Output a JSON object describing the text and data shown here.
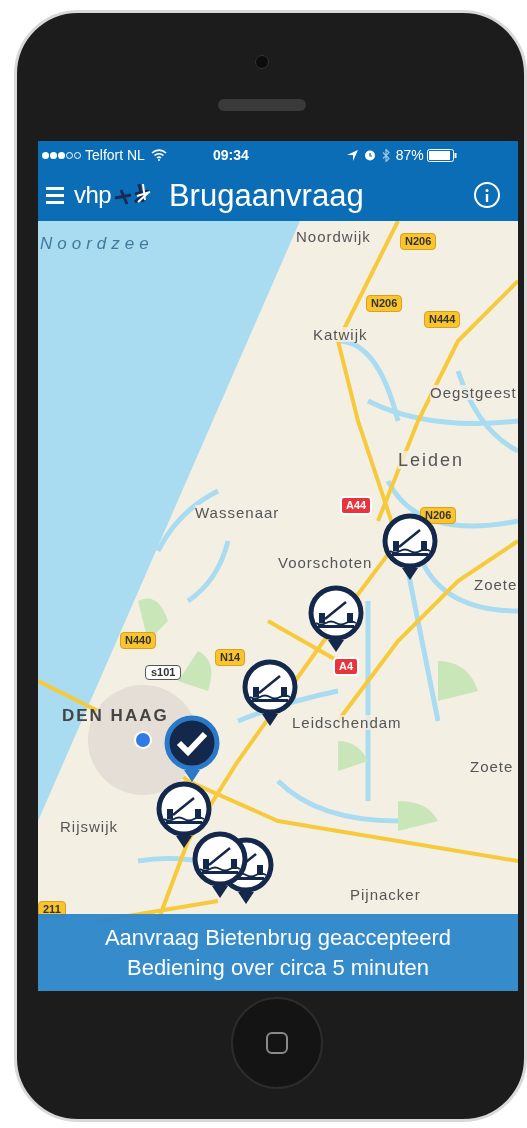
{
  "status_bar": {
    "carrier": "Telfort NL",
    "time": "09:34",
    "battery": "87%"
  },
  "header": {
    "logo": "vhp",
    "title": "Brugaanvraag"
  },
  "map": {
    "labels": [
      {
        "text": "Noordzee",
        "kind": "sea"
      },
      {
        "text": "Noordwijk",
        "kind": "town"
      },
      {
        "text": "N206",
        "kind": "road"
      },
      {
        "text": "N206",
        "kind": "road"
      },
      {
        "text": "N444",
        "kind": "road"
      },
      {
        "text": "Katwijk",
        "kind": "town"
      },
      {
        "text": "Oegstgeest",
        "kind": "town"
      },
      {
        "text": "Leiden",
        "kind": "city"
      },
      {
        "text": "A44",
        "kind": "motorway"
      },
      {
        "text": "N206",
        "kind": "road"
      },
      {
        "text": "Wassenaar",
        "kind": "town"
      },
      {
        "text": "Voorschoten",
        "kind": "town"
      },
      {
        "text": "Zoete",
        "kind": "town"
      },
      {
        "text": "N440",
        "kind": "road"
      },
      {
        "text": "N14",
        "kind": "road"
      },
      {
        "text": "s101",
        "kind": "city_road"
      },
      {
        "text": "A4",
        "kind": "motorway"
      },
      {
        "text": "DEN HAAG",
        "kind": "capital"
      },
      {
        "text": "Leidschendam",
        "kind": "town"
      },
      {
        "text": "Zoete",
        "kind": "town"
      },
      {
        "text": "Rijswijk",
        "kind": "town"
      },
      {
        "text": "Pijnacker",
        "kind": "town"
      },
      {
        "text": "211",
        "kind": "road"
      }
    ],
    "pins": [
      {
        "kind": "bridge"
      },
      {
        "kind": "bridge"
      },
      {
        "kind": "bridge"
      },
      {
        "kind": "accepted"
      },
      {
        "kind": "bridge"
      },
      {
        "kind": "bridge_stack"
      }
    ]
  },
  "banner": {
    "lines": [
      "Aanvraag Bietenbrug geaccepteerd",
      "Bediening over circa 5 minuten"
    ]
  }
}
